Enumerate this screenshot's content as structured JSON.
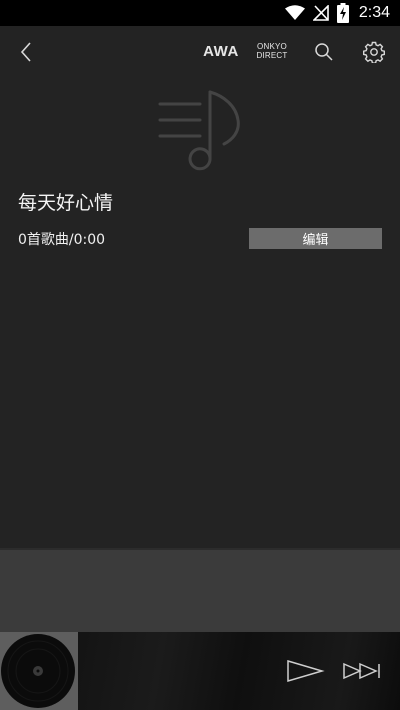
{
  "status_bar": {
    "time": "2:34",
    "icons": [
      "wifi-icon",
      "no-signal-icon",
      "battery-charging-icon"
    ]
  },
  "app_bar": {
    "back_icon": "chevron-left-icon",
    "awa_label": "AWA",
    "onkyo_line1": "ONKYO",
    "onkyo_line2": "DIRECT",
    "search_icon": "search-icon",
    "settings_icon": "gear-icon"
  },
  "playlist": {
    "art_icon": "music-note-list-icon",
    "title": "每天好心情",
    "meta": "0首歌曲/0:00",
    "edit_label": "编辑"
  },
  "player": {
    "album_icon": "vinyl-record-icon",
    "play_icon": "play-icon",
    "next_icon": "skip-next-icon"
  },
  "colors": {
    "background": "#232323",
    "edit_button": "#6c6c6c",
    "lower_band": "#3b3b3b",
    "player_bar": "#141414"
  }
}
